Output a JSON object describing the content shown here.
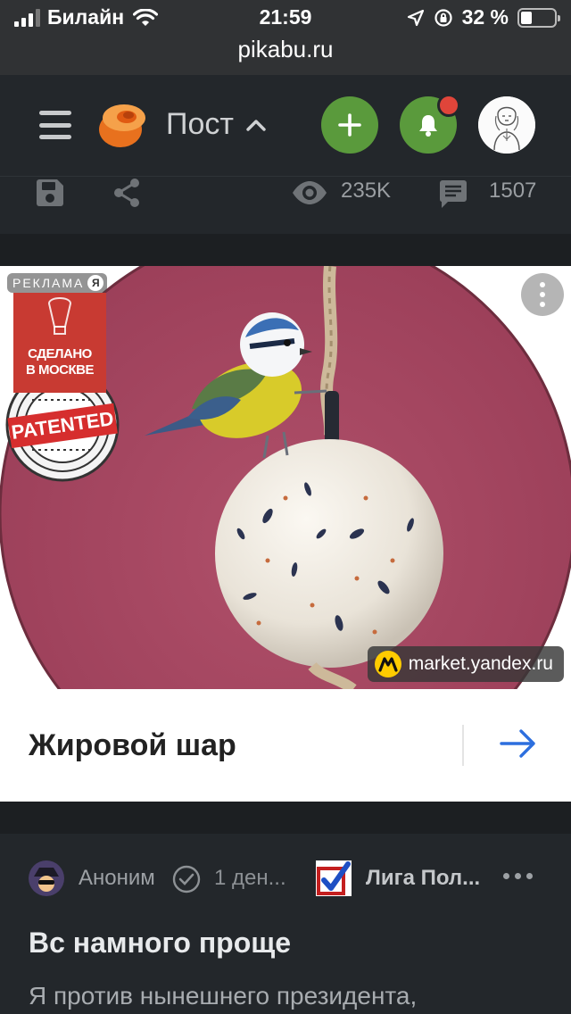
{
  "status_bar": {
    "carrier": "Билайн",
    "time": "21:59",
    "battery": "32 %",
    "battery_fraction": 0.32,
    "url": "pikabu.ru"
  },
  "header": {
    "title": "Пост",
    "add_icon": "plus-icon",
    "notification_icon": "bell-icon",
    "menu_icon": "hamburger-icon"
  },
  "post_stats": {
    "views": "235K",
    "comments": "1507"
  },
  "ad": {
    "badge_label": "РЕКЛАМА",
    "badge_mark": "Я",
    "made_in_label": "СДЕЛАНО В МОСКВЕ",
    "patent_label": "PATENTED",
    "source": "market.yandex.ru",
    "title": "Жировой шар"
  },
  "next_post": {
    "author": "Аноним",
    "time": "1 ден...",
    "community": "Лига Пол...",
    "title": "Вс намного проще",
    "text": "Я против нынешнего президента,"
  },
  "colors": {
    "accent_green": "#5a9a3c",
    "notification_dot": "#e0453a",
    "link_arrow": "#2d6fde",
    "background": "#23272b"
  }
}
